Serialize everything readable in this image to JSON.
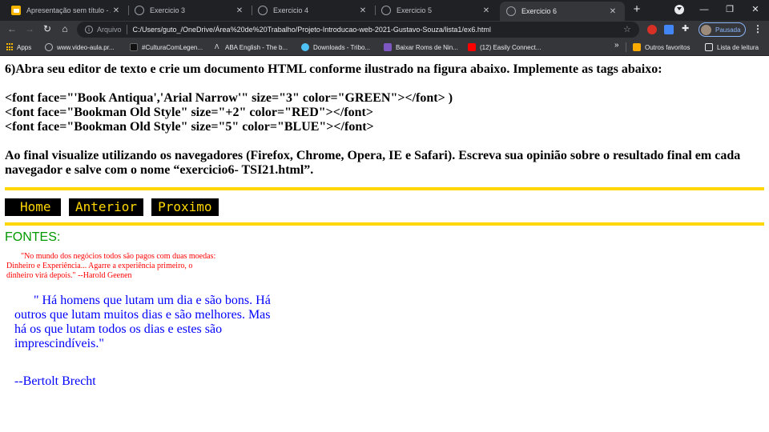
{
  "tabs": [
    {
      "title": "Apresentação sem título - Ap",
      "icon": "slides-icon",
      "active": false
    },
    {
      "title": "Exercicio 3",
      "icon": "globe-icon",
      "active": false
    },
    {
      "title": "Exercicio 4",
      "icon": "globe-icon",
      "active": false
    },
    {
      "title": "Exercicio 5",
      "icon": "globe-icon",
      "active": false
    },
    {
      "title": "Exercicio 6",
      "icon": "globe-icon",
      "active": true
    }
  ],
  "toolbar": {
    "scheme_label": "Arquivo",
    "url": "C:/Users/guto_/OneDrive/Área%20de%20Trabalho/Projeto-Introducao-web-2021-Gustavo-Souza/lista1/ex6.html",
    "profile_label": "Pausada"
  },
  "bookmarks": [
    {
      "label": "Apps",
      "icon": "apps-icon"
    },
    {
      "label": "www.video-aula.pr...",
      "icon": "globe-icon"
    },
    {
      "label": "#CulturaComLegen...",
      "icon": "site-icon"
    },
    {
      "label": "ABA English - The b...",
      "icon": "aba-icon"
    },
    {
      "label": "Downloads - Tribo...",
      "icon": "download-site-icon"
    },
    {
      "label": "Baixar Roms de Nin...",
      "icon": "roms-icon"
    },
    {
      "label": "(12) Easily Connect...",
      "icon": "youtube-icon"
    }
  ],
  "bookmarks_right": {
    "more": "»",
    "other": "Outros favoritos",
    "reading": "Lista de leitura"
  },
  "page": {
    "instruction": "6)Abra seu editor de texto e crie um documento HTML conforme ilustrado na figura abaixo. Implemente as tags abaixo:",
    "tag_lines": [
      "<font face=\"'Book Antiqua','Arial Narrow'\" size=\"3\" color=\"GREEN\"></font> )",
      "<font face=\"Bookman Old Style\" size=\"+2\" color=\"RED\"></font>",
      "<font face=\"Bookman Old Style\" size=\"5\" color=\"BLUE\"></font>"
    ],
    "final_text": "Ao final visualize utilizando os navegadores (Firefox, Chrome, Opera, IE e Safari). Escreva sua opinião sobre o resultado final em cada navegador e salve com o nome “exercicio6- TSI21.html”.",
    "nav_buttons": [
      "Home",
      "Anterior",
      "Proximo"
    ],
    "fontes_label": "FONTES:",
    "quote_red": "\"No mundo dos negócios todos são pagos com duas moedas: Dinheiro e Experiência... Agarre a experiência primeiro, o dinheiro virá depois.\" --Harold Geenen",
    "quote_blue": "\" Há homens que lutam um dia e são bons. Há outros que lutam muitos dias e são melhores. Mas há os que lutam todos os dias e estes são imprescindíveis.\"",
    "quote_blue_author": "--Bertolt Brecht"
  },
  "colors": {
    "accent_yellow": "#ffd700",
    "green": "#009900",
    "red": "#ff0000",
    "blue": "#0000ff"
  }
}
